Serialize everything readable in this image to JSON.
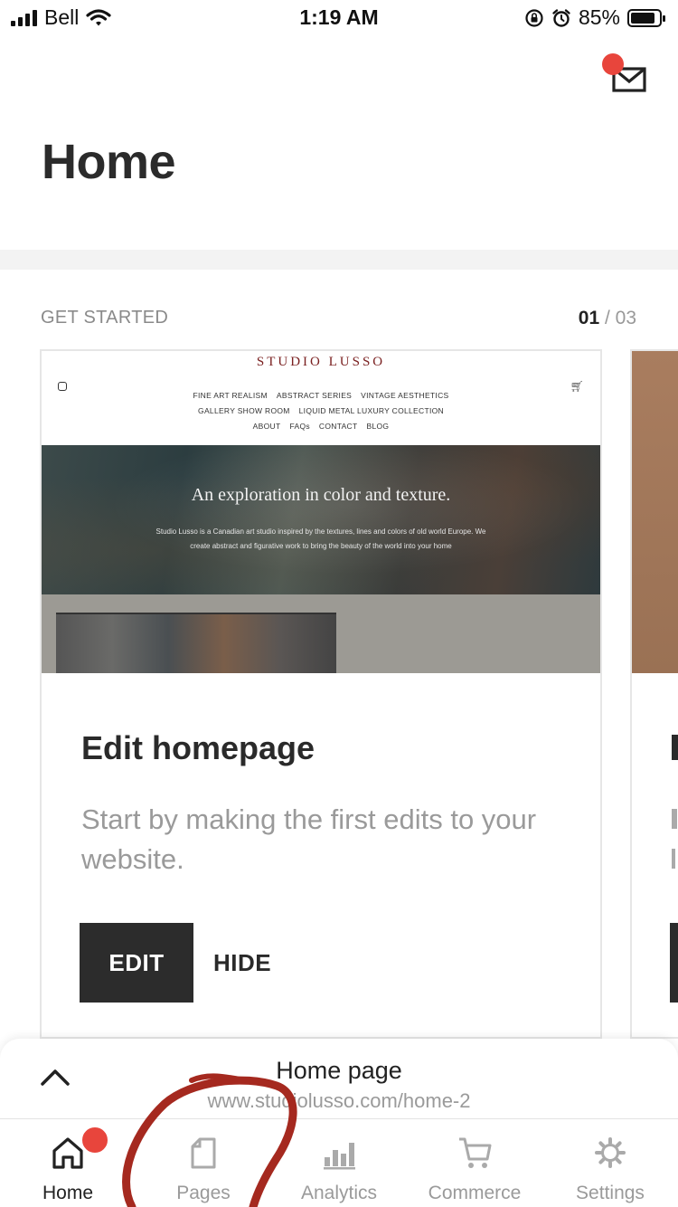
{
  "status_bar": {
    "carrier": "Bell",
    "time": "1:19 AM",
    "battery_percent": "85%",
    "battery_level": 0.85,
    "icons": [
      "signal-icon",
      "wifi-icon",
      "rotation-lock-icon",
      "alarm-icon",
      "battery-icon"
    ]
  },
  "header": {
    "title": "Home",
    "mail_icon": "mail-icon",
    "mail_has_notification": true
  },
  "section": {
    "label": "GET STARTED",
    "pager_current": "01",
    "pager_separator": " / ",
    "pager_total": "03"
  },
  "card": {
    "preview": {
      "brand": "STUDIO LUSSO",
      "nav_row1": [
        "FINE ART REALISM",
        "ABSTRACT SERIES",
        "VINTAGE AESTHETICS"
      ],
      "nav_row2": [
        "GALLERY SHOW ROOM",
        "LIQUID METAL LUXURY COLLECTION"
      ],
      "nav_row3": [
        "ABOUT",
        "FAQs",
        "CONTACT",
        "BLOG"
      ],
      "headline": "An exploration in color and texture.",
      "body_line1": "Studio Lusso is a Canadian art studio inspired by the textures, lines and colors of old world Europe. We",
      "body_line2": "create abstract and figurative work to bring the beauty of the world into your home"
    },
    "title": "Edit homepage",
    "description": "Start by making the first edits to your website.",
    "primary_button": "EDIT",
    "secondary_button": "HIDE"
  },
  "sheet": {
    "title": "Home page",
    "url": "www.studiolusso.com/home-2",
    "chevron_icon": "chevron-up-icon"
  },
  "tabs": [
    {
      "label": "Home",
      "icon": "home-icon",
      "active": true,
      "badge": true
    },
    {
      "label": "Pages",
      "icon": "pages-icon",
      "active": false
    },
    {
      "label": "Analytics",
      "icon": "analytics-icon",
      "active": false
    },
    {
      "label": "Commerce",
      "icon": "cart-icon",
      "active": false
    },
    {
      "label": "Settings",
      "icon": "gear-icon",
      "active": false
    }
  ],
  "colors": {
    "accent_red": "#e8453c",
    "button_dark": "#2c2c2c",
    "annotation": "#a5291f"
  }
}
